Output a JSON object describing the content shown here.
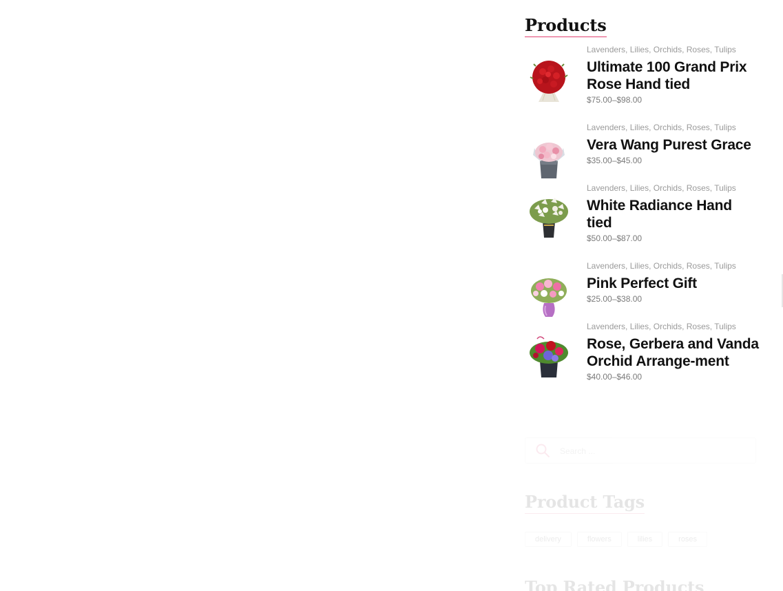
{
  "products_widget": {
    "title": "Products",
    "items": [
      {
        "categories": [
          "Lavenders",
          "Lilies",
          "Orchids",
          "Roses",
          "Tulips"
        ],
        "name": "Ultimate 100 Grand Prix Rose Hand tied",
        "price": "$75.00–$98.00",
        "image_icon": "red-rose-bouquet-icon"
      },
      {
        "categories": [
          "Lavenders",
          "Lilies",
          "Orchids",
          "Roses",
          "Tulips"
        ],
        "name": "Vera Wang Purest Grace",
        "price": "$35.00–$45.00",
        "image_icon": "pink-bouquet-box-icon"
      },
      {
        "categories": [
          "Lavenders",
          "Lilies",
          "Orchids",
          "Roses",
          "Tulips"
        ],
        "name": "White Radiance Hand tied",
        "price": "$50.00–$87.00",
        "image_icon": "white-lily-bouquet-icon"
      },
      {
        "categories": [
          "Lavenders",
          "Lilies",
          "Orchids",
          "Roses",
          "Tulips"
        ],
        "name": "Pink Perfect Gift",
        "price": "$25.00–$38.00",
        "image_icon": "pink-vase-bouquet-icon"
      },
      {
        "categories": [
          "Lavenders",
          "Lilies",
          "Orchids",
          "Roses",
          "Tulips"
        ],
        "name": "Rose, Gerbera and Vanda Orchid Arrange-ment",
        "price": "$40.00–$46.00",
        "image_icon": "mixed-flower-arrangement-icon"
      }
    ]
  },
  "search": {
    "placeholder": "Search ...",
    "icon": "search-icon",
    "icon_color": "#e0406f"
  },
  "tags_widget": {
    "title": "Product Tags",
    "tags": [
      "delivery",
      "flowers",
      "lilies",
      "roses"
    ]
  },
  "top_rated_widget": {
    "title": "Top Rated Products"
  },
  "colors": {
    "accent": "#e0406f",
    "text": "#111111",
    "muted": "#9a9a9a"
  }
}
